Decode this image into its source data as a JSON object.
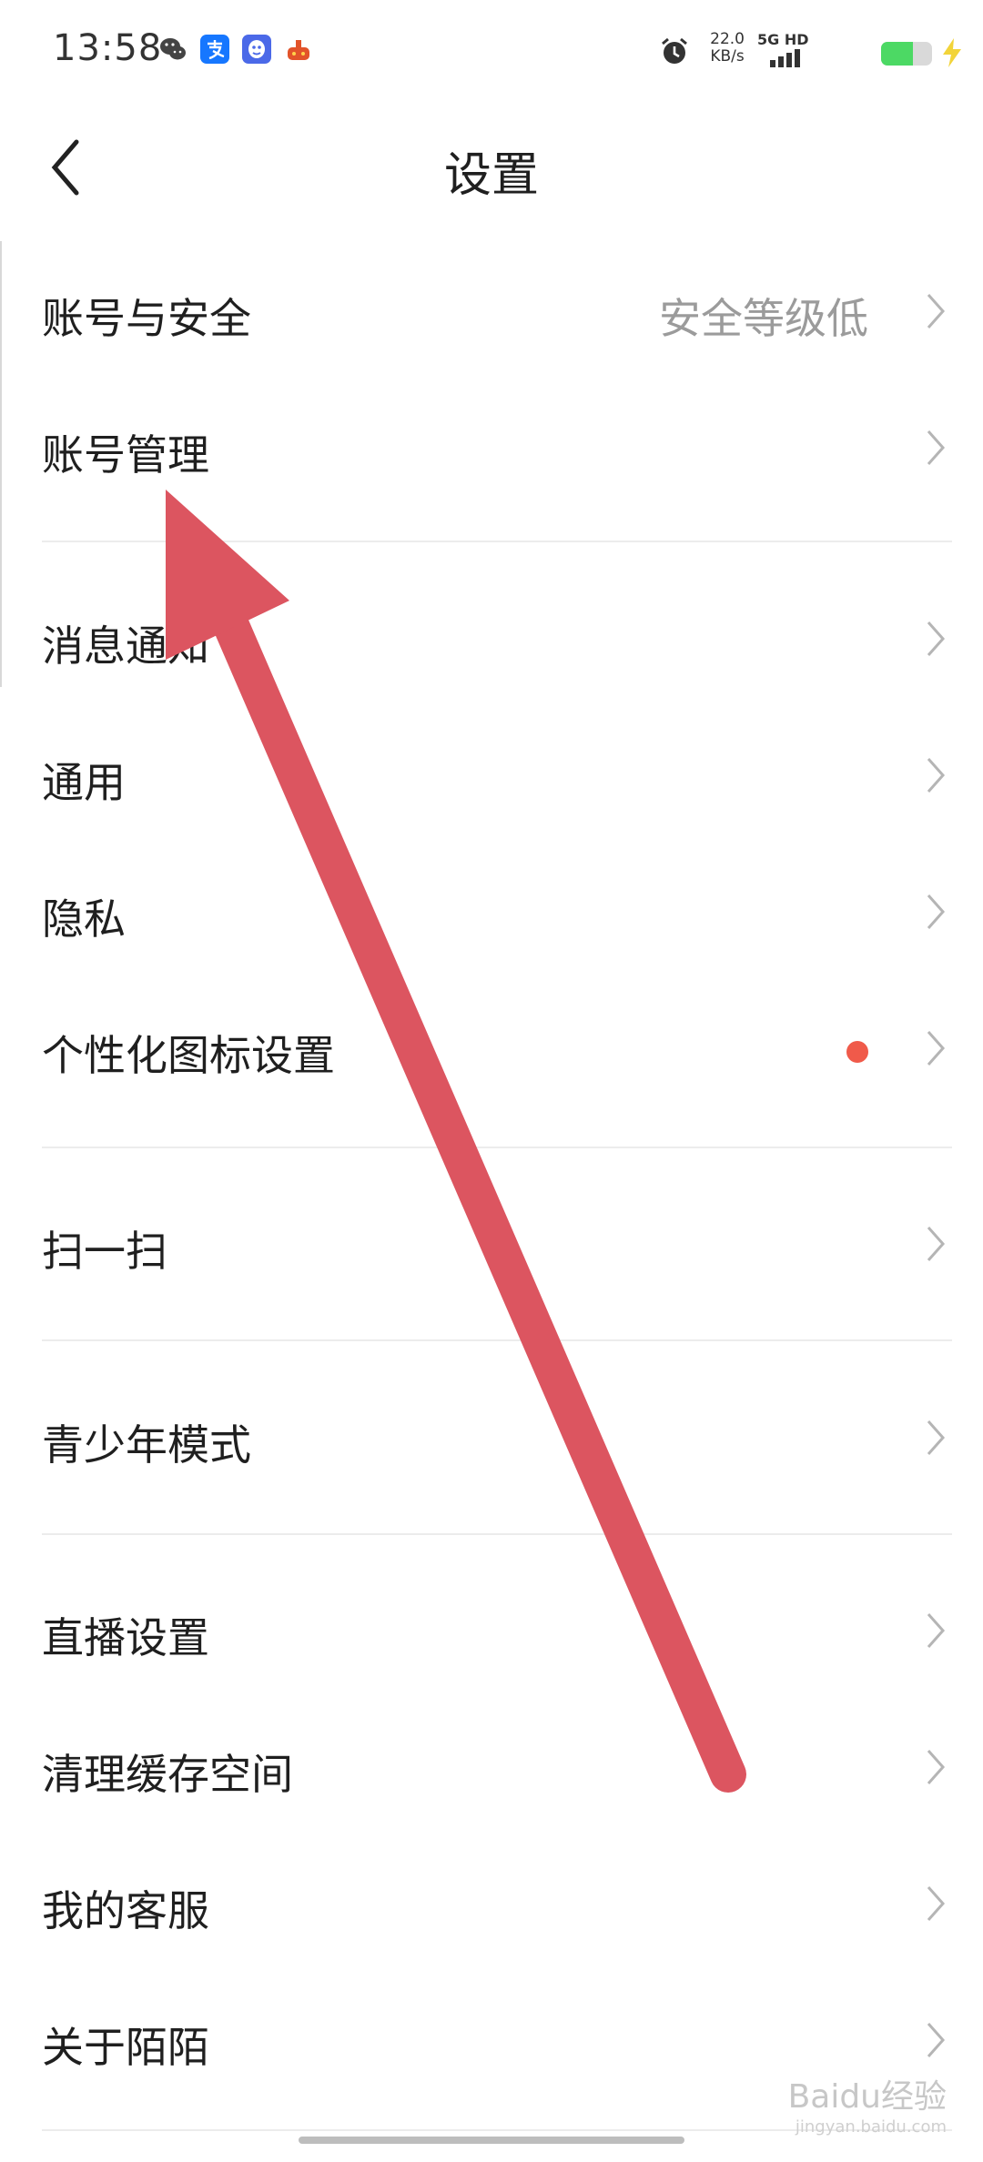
{
  "status_bar": {
    "time": "13:58",
    "net_speed_value": "22.0",
    "net_speed_unit": "KB/s",
    "network_label": "5G HD",
    "battery_level": 0.62,
    "icons": [
      "wechat-icon",
      "alipay-icon",
      "qq-icon",
      "game-icon",
      "alarm-icon",
      "signal-icon",
      "battery-icon",
      "charging-icon"
    ]
  },
  "header": {
    "title": "设置"
  },
  "settings": {
    "items": [
      {
        "label": "账号与安全",
        "value": "安全等级低"
      },
      {
        "label": "账号管理"
      },
      {
        "label": "消息通知"
      },
      {
        "label": "通用"
      },
      {
        "label": "隐私"
      },
      {
        "label": "个性化图标设置"
      },
      {
        "label": "扫一扫"
      },
      {
        "label": "青少年模式"
      },
      {
        "label": "直播设置"
      },
      {
        "label": "清理缓存空间"
      },
      {
        "label": "我的客服"
      },
      {
        "label": "关于陌陌"
      }
    ]
  },
  "colors": {
    "accent_dot": "#f05a4a",
    "annotation_arrow": "#dc5560",
    "battery_fill": "#4cd964"
  },
  "watermark": {
    "text": "Baidu经验",
    "url_text": "jingyan.baidu.com"
  }
}
